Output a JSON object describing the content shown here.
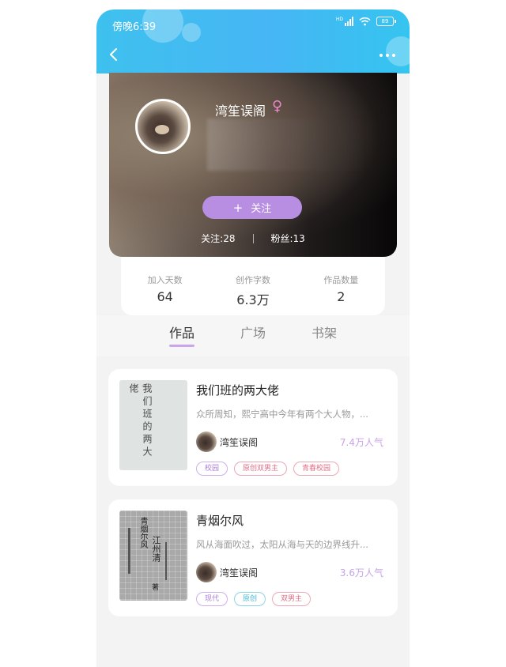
{
  "status_bar": {
    "time": "傍晚6:39",
    "network": "HD",
    "battery": "89"
  },
  "profile": {
    "username": "湾笙误阁",
    "gender": "♀",
    "follow_label": "关注",
    "following_label": "关注:",
    "following_count": "28",
    "fans_label": "粉丝:",
    "fans_count": "13"
  },
  "stats": [
    {
      "label": "加入天数",
      "value": "64"
    },
    {
      "label": "创作字数",
      "value": "6.3万"
    },
    {
      "label": "作品数量",
      "value": "2"
    }
  ],
  "tabs": [
    {
      "label": "作品",
      "active": true
    },
    {
      "label": "广场",
      "active": false
    },
    {
      "label": "书架",
      "active": false
    }
  ],
  "books": [
    {
      "title": "我们班的两大佬",
      "description": "众所周知，熙宁高中今年有两个大人物，...",
      "author": "湾笙误阁",
      "popularity": "7.4万人气",
      "tags": [
        "校园",
        "原创双男主",
        "青春校园"
      ],
      "tag_styles": [
        "purple",
        "pink",
        "pink"
      ],
      "cover_text": "我们班的两大佬"
    },
    {
      "title": "青烟尔风",
      "description": "风从海面吹过，太阳从海与天的边界线升...",
      "author": "湾笙误阁",
      "popularity": "3.6万人气",
      "tags": [
        "现代",
        "原创",
        "双男主"
      ],
      "tag_styles": [
        "purple",
        "blue",
        "pink"
      ],
      "cover_text_1": "青烟尔风",
      "cover_text_2": "江州清",
      "cover_text_3": "著"
    }
  ],
  "colors": {
    "header_blue": "#46b6f4",
    "follow_button": "#b88ee3",
    "popularity": "#c7a3ea",
    "tab_underline": "#c9a6ec",
    "gender_pink": "#e889c9"
  },
  "icons": [
    "back-arrow-icon",
    "more-dots-icon",
    "signal-icon",
    "wifi-icon",
    "battery-icon",
    "female-icon",
    "plus-icon"
  ]
}
